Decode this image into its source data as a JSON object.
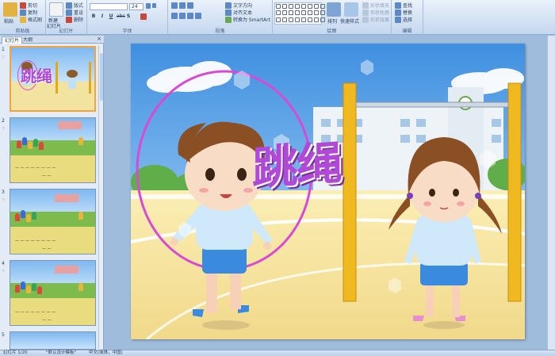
{
  "ribbon": {
    "clipboard": {
      "paste": "粘贴",
      "cut": "剪切",
      "copy": "复制",
      "format_painter": "格式刷",
      "group": "剪贴板"
    },
    "slides": {
      "new_slide": "新建",
      "new_slide2": "幻灯片",
      "layout": "版式",
      "reset": "重设",
      "delete": "删除",
      "group": "幻灯片"
    },
    "font": {
      "font_name": "",
      "font_size": "24",
      "bold": "B",
      "italic": "I",
      "underline": "U",
      "strike": "abc",
      "shadow": "S",
      "group": "字体"
    },
    "paragraph": {
      "text_direction": "文字方向",
      "align_text": "对齐文本",
      "smartart": "转换为 SmartArt",
      "group": "段落"
    },
    "drawing": {
      "arrange": "排列",
      "quick_styles": "快速样式",
      "shape_fill": "形状填充",
      "shape_outline": "形状轮廓",
      "shape_effects": "形状效果",
      "group": "绘图"
    },
    "editing": {
      "find": "查找",
      "replace": "替换",
      "select": "选择",
      "group": "编辑"
    }
  },
  "pane": {
    "tabs": [
      "幻灯片",
      "大纲"
    ],
    "close": "×",
    "thumbnails": [
      {
        "num": "1",
        "title": "跳绳"
      },
      {
        "num": "2"
      },
      {
        "num": "3"
      },
      {
        "num": "4"
      },
      {
        "num": "5"
      }
    ]
  },
  "slide": {
    "title": "跳绳"
  },
  "status": {
    "slide_info": "幻灯片 1/20",
    "theme": "\"默认设计模板\"",
    "language": "中文(简体，中国)"
  },
  "colors": {
    "ribbon": "#d3e1f3",
    "accent": "#f3a43c",
    "title_purple": "#b04ad6",
    "frame": "#9fbcdd"
  }
}
